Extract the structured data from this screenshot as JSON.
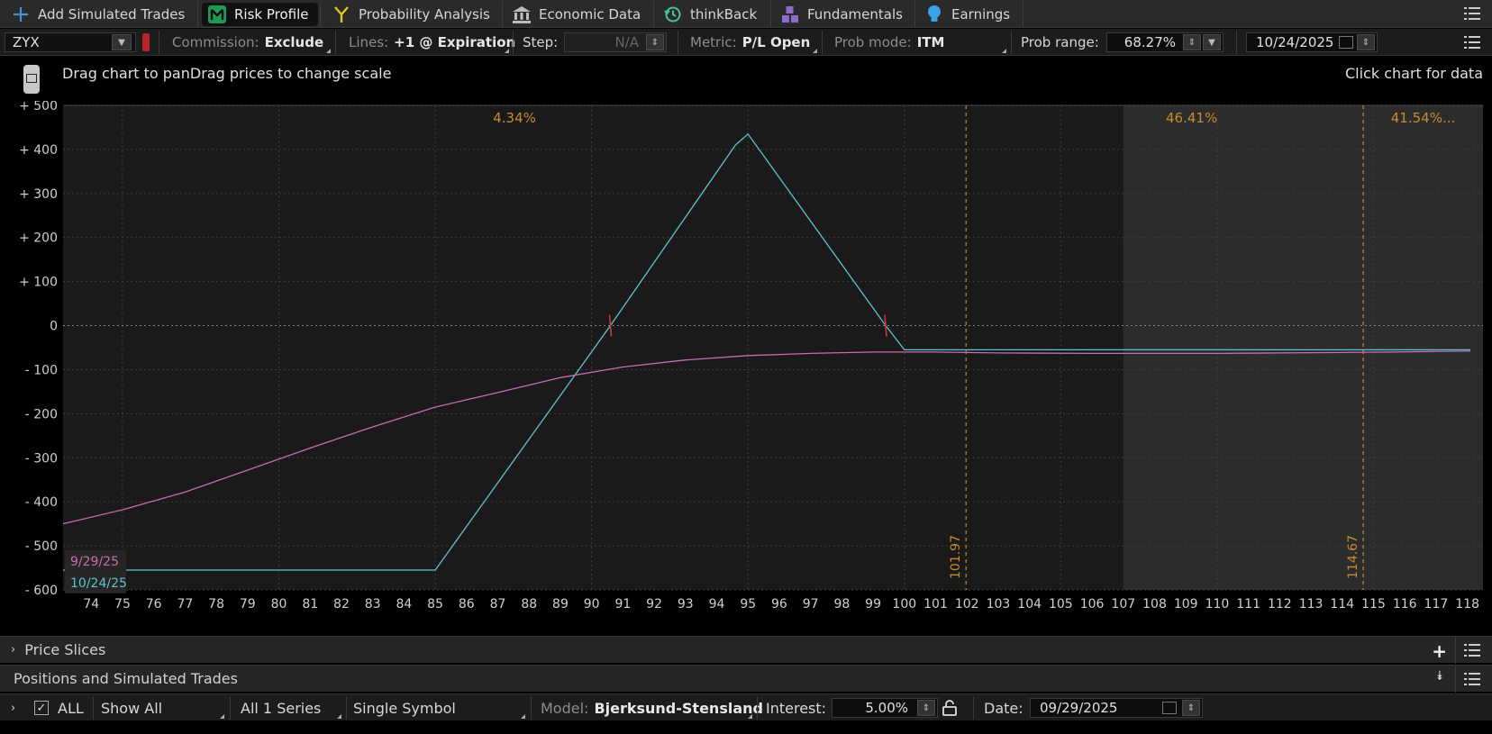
{
  "tabs": [
    {
      "label": "Add Simulated Trades",
      "icon": "plus-icon"
    },
    {
      "label": "Risk Profile",
      "icon": "risk-profile-icon",
      "active": true
    },
    {
      "label": "Probability Analysis",
      "icon": "probability-fork-icon"
    },
    {
      "label": "Economic Data",
      "icon": "bank-building-icon"
    },
    {
      "label": "thinkBack",
      "icon": "history-clock-icon"
    },
    {
      "label": "Fundamentals",
      "icon": "blocks-icon"
    },
    {
      "label": "Earnings",
      "icon": "lightbulb-icon"
    }
  ],
  "controls": {
    "symbol": "ZYX",
    "commission_label": "Commission:",
    "commission_value": "Exclude",
    "lines_label": "Lines:",
    "lines_value": "+1 @ Expiration",
    "step_label": "Step:",
    "step_value": "N/A",
    "metric_label": "Metric:",
    "metric_value": "P/L Open",
    "prob_mode_label": "Prob mode:",
    "prob_mode_value": "ITM",
    "prob_range_label": "Prob range:",
    "prob_range_value": "68.27%",
    "date_value": "10/24/2025"
  },
  "hints": {
    "left": "Drag chart to panDrag prices to change scale",
    "right": "Click chart for data"
  },
  "colors": {
    "expiration_line": "#5fc3cf",
    "current_line": "#c86bb0",
    "prob_marker": "#c88a2e",
    "breakeven_marker": "#d23a3a"
  },
  "chart_data": {
    "type": "line",
    "x_range": [
      73.1,
      118.5
    ],
    "ylim": [
      -600,
      500
    ],
    "x_ticks": [
      74,
      75,
      76,
      77,
      78,
      79,
      80,
      81,
      82,
      83,
      84,
      85,
      86,
      87,
      88,
      89,
      90,
      91,
      92,
      93,
      94,
      95,
      96,
      97,
      98,
      99,
      100,
      101,
      102,
      103,
      104,
      105,
      106,
      107,
      108,
      109,
      110,
      111,
      112,
      113,
      114,
      115,
      116,
      117,
      118
    ],
    "y_ticks": [
      {
        "value": 500,
        "label": "+ 500"
      },
      {
        "value": 400,
        "label": "+ 400"
      },
      {
        "value": 300,
        "label": "+ 300"
      },
      {
        "value": 200,
        "label": "+ 200"
      },
      {
        "value": 100,
        "label": "+ 100"
      },
      {
        "value": 0,
        "label": "0"
      },
      {
        "value": -100,
        "label": "- 100"
      },
      {
        "value": -200,
        "label": "- 200"
      },
      {
        "value": -300,
        "label": "- 300"
      },
      {
        "value": -400,
        "label": "- 400"
      },
      {
        "value": -500,
        "label": "- 500"
      },
      {
        "value": -600,
        "label": "- 600"
      }
    ],
    "probability_range": [
      101.97,
      114.67
    ],
    "prob_markers": [
      {
        "x": 101.97,
        "label": "101.97"
      },
      {
        "x": 114.67,
        "label": "114.67"
      }
    ],
    "zone_percents": [
      "4.34%",
      "46.41%",
      "41.54%..."
    ],
    "shaded_from": 107.0,
    "breakevens": [
      90.6,
      99.4
    ],
    "series": [
      {
        "name": "10/24/25",
        "points": [
          [
            73.1,
            -555
          ],
          [
            85,
            -555
          ],
          [
            90.6,
            0
          ],
          [
            94.6,
            410
          ],
          [
            95,
            435
          ],
          [
            99.4,
            0
          ],
          [
            100,
            -55
          ],
          [
            118.1,
            -55
          ]
        ]
      },
      {
        "name": "9/29/25",
        "points": [
          [
            73.1,
            -450
          ],
          [
            75,
            -418
          ],
          [
            77,
            -378
          ],
          [
            79,
            -328
          ],
          [
            81,
            -278
          ],
          [
            83,
            -230
          ],
          [
            85,
            -185
          ],
          [
            87,
            -152
          ],
          [
            89,
            -118
          ],
          [
            91,
            -94
          ],
          [
            93,
            -78
          ],
          [
            95,
            -68
          ],
          [
            97,
            -63
          ],
          [
            99,
            -60
          ],
          [
            101,
            -60
          ],
          [
            103,
            -62
          ],
          [
            106,
            -63
          ],
          [
            110,
            -63
          ],
          [
            114,
            -61
          ],
          [
            118.1,
            -58
          ]
        ]
      }
    ]
  },
  "panels": {
    "price_slices": "Price Slices",
    "positions": "Positions and Simulated Trades"
  },
  "bottom": {
    "all_label": "ALL",
    "show_all": "Show All",
    "series": "All 1 Series",
    "single_symbol": "Single Symbol",
    "model_label": "Model:",
    "model_value": "Bjerksund-Stensland",
    "interest_label": "Interest:",
    "interest_value": "5.00%",
    "date_label": "Date:",
    "date_value": "09/29/2025"
  }
}
